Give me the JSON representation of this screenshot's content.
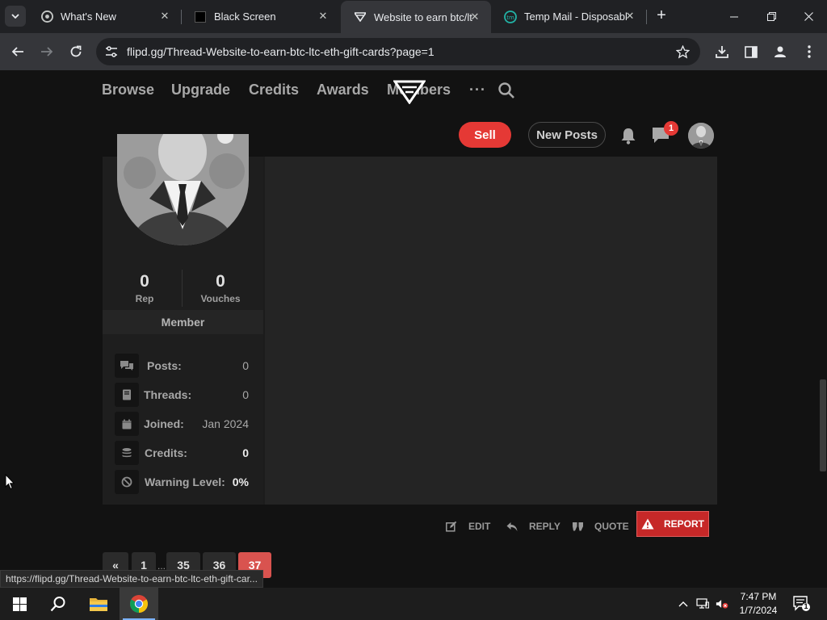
{
  "browser": {
    "tabs": [
      {
        "title": "What's New",
        "icon": "chrome-icon"
      },
      {
        "title": "Black Screen",
        "icon": "black-square-icon"
      },
      {
        "title": "Website to earn btc/ltc",
        "icon": "flipd-logo-icon",
        "active": true
      },
      {
        "title": "Temp Mail - Disposable",
        "icon": "temp-mail-icon"
      }
    ],
    "url": "flipd.gg/Thread-Website-to-earn-btc-ltc-eth-gift-cards?page=1"
  },
  "site": {
    "nav": {
      "browse": "Browse",
      "upgrade": "Upgrade",
      "credits": "Credits",
      "awards": "Awards",
      "members": "Members",
      "more": "···"
    },
    "sell_label": "Sell",
    "new_posts_label": "New Posts",
    "messages_badge": "1"
  },
  "post": {
    "author": {
      "rep_value": "0",
      "rep_label": "Rep",
      "vouches_value": "0",
      "vouches_label": "Vouches",
      "role": "Member",
      "stats": [
        {
          "label": "Posts:",
          "value": "0",
          "icon": "comments-icon"
        },
        {
          "label": "Threads:",
          "value": "0",
          "icon": "book-icon"
        },
        {
          "label": "Joined:",
          "value": "Jan 2024",
          "icon": "calendar-icon"
        },
        {
          "label": "Credits:",
          "value": "0",
          "icon": "coins-icon"
        },
        {
          "label": "Warning Level:",
          "value": "0%",
          "icon": "ban-icon"
        }
      ]
    },
    "actions": {
      "edit": "EDIT",
      "reply": "REPLY",
      "quote": "QUOTE",
      "report": "REPORT"
    }
  },
  "pagination": {
    "prev": "«",
    "pages": [
      "1",
      "35",
      "36",
      "37"
    ],
    "ellipsis": "...",
    "current": "37"
  },
  "status_bar": {
    "link": "https://flipd.gg/Thread-Website-to-earn-btc-ltc-eth-gift-car..."
  },
  "taskbar": {
    "time": "7:47 PM",
    "date": "1/7/2024",
    "notification_count": "1"
  },
  "colors": {
    "accent_red": "#e53935",
    "page_bg": "#121212",
    "current_page": "#d9534f"
  }
}
